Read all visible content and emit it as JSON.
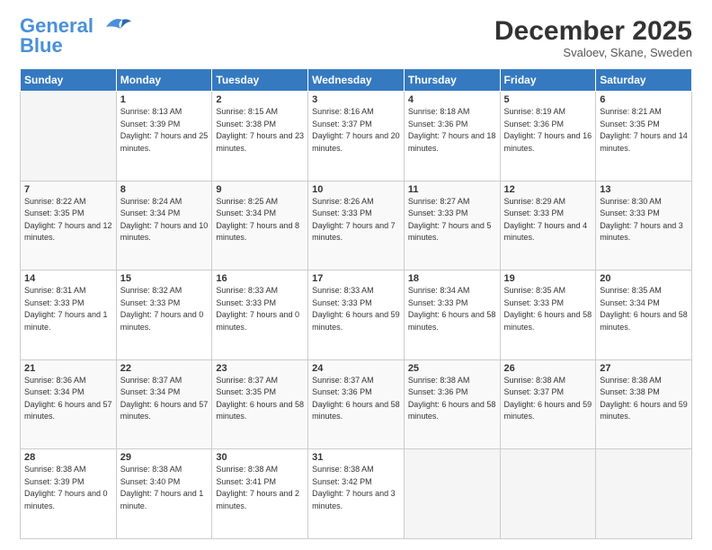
{
  "logo": {
    "general": "General",
    "blue": "Blue"
  },
  "header": {
    "month": "December 2025",
    "location": "Svaloev, Skane, Sweden"
  },
  "days_of_week": [
    "Sunday",
    "Monday",
    "Tuesday",
    "Wednesday",
    "Thursday",
    "Friday",
    "Saturday"
  ],
  "weeks": [
    [
      {
        "num": "",
        "sunrise": "",
        "sunset": "",
        "daylight": "",
        "empty": true
      },
      {
        "num": "1",
        "sunrise": "Sunrise: 8:13 AM",
        "sunset": "Sunset: 3:39 PM",
        "daylight": "Daylight: 7 hours and 25 minutes."
      },
      {
        "num": "2",
        "sunrise": "Sunrise: 8:15 AM",
        "sunset": "Sunset: 3:38 PM",
        "daylight": "Daylight: 7 hours and 23 minutes."
      },
      {
        "num": "3",
        "sunrise": "Sunrise: 8:16 AM",
        "sunset": "Sunset: 3:37 PM",
        "daylight": "Daylight: 7 hours and 20 minutes."
      },
      {
        "num": "4",
        "sunrise": "Sunrise: 8:18 AM",
        "sunset": "Sunset: 3:36 PM",
        "daylight": "Daylight: 7 hours and 18 minutes."
      },
      {
        "num": "5",
        "sunrise": "Sunrise: 8:19 AM",
        "sunset": "Sunset: 3:36 PM",
        "daylight": "Daylight: 7 hours and 16 minutes."
      },
      {
        "num": "6",
        "sunrise": "Sunrise: 8:21 AM",
        "sunset": "Sunset: 3:35 PM",
        "daylight": "Daylight: 7 hours and 14 minutes."
      }
    ],
    [
      {
        "num": "7",
        "sunrise": "Sunrise: 8:22 AM",
        "sunset": "Sunset: 3:35 PM",
        "daylight": "Daylight: 7 hours and 12 minutes."
      },
      {
        "num": "8",
        "sunrise": "Sunrise: 8:24 AM",
        "sunset": "Sunset: 3:34 PM",
        "daylight": "Daylight: 7 hours and 10 minutes."
      },
      {
        "num": "9",
        "sunrise": "Sunrise: 8:25 AM",
        "sunset": "Sunset: 3:34 PM",
        "daylight": "Daylight: 7 hours and 8 minutes."
      },
      {
        "num": "10",
        "sunrise": "Sunrise: 8:26 AM",
        "sunset": "Sunset: 3:33 PM",
        "daylight": "Daylight: 7 hours and 7 minutes."
      },
      {
        "num": "11",
        "sunrise": "Sunrise: 8:27 AM",
        "sunset": "Sunset: 3:33 PM",
        "daylight": "Daylight: 7 hours and 5 minutes."
      },
      {
        "num": "12",
        "sunrise": "Sunrise: 8:29 AM",
        "sunset": "Sunset: 3:33 PM",
        "daylight": "Daylight: 7 hours and 4 minutes."
      },
      {
        "num": "13",
        "sunrise": "Sunrise: 8:30 AM",
        "sunset": "Sunset: 3:33 PM",
        "daylight": "Daylight: 7 hours and 3 minutes."
      }
    ],
    [
      {
        "num": "14",
        "sunrise": "Sunrise: 8:31 AM",
        "sunset": "Sunset: 3:33 PM",
        "daylight": "Daylight: 7 hours and 1 minute."
      },
      {
        "num": "15",
        "sunrise": "Sunrise: 8:32 AM",
        "sunset": "Sunset: 3:33 PM",
        "daylight": "Daylight: 7 hours and 0 minutes."
      },
      {
        "num": "16",
        "sunrise": "Sunrise: 8:33 AM",
        "sunset": "Sunset: 3:33 PM",
        "daylight": "Daylight: 7 hours and 0 minutes."
      },
      {
        "num": "17",
        "sunrise": "Sunrise: 8:33 AM",
        "sunset": "Sunset: 3:33 PM",
        "daylight": "Daylight: 6 hours and 59 minutes."
      },
      {
        "num": "18",
        "sunrise": "Sunrise: 8:34 AM",
        "sunset": "Sunset: 3:33 PM",
        "daylight": "Daylight: 6 hours and 58 minutes."
      },
      {
        "num": "19",
        "sunrise": "Sunrise: 8:35 AM",
        "sunset": "Sunset: 3:33 PM",
        "daylight": "Daylight: 6 hours and 58 minutes."
      },
      {
        "num": "20",
        "sunrise": "Sunrise: 8:35 AM",
        "sunset": "Sunset: 3:34 PM",
        "daylight": "Daylight: 6 hours and 58 minutes."
      }
    ],
    [
      {
        "num": "21",
        "sunrise": "Sunrise: 8:36 AM",
        "sunset": "Sunset: 3:34 PM",
        "daylight": "Daylight: 6 hours and 57 minutes."
      },
      {
        "num": "22",
        "sunrise": "Sunrise: 8:37 AM",
        "sunset": "Sunset: 3:34 PM",
        "daylight": "Daylight: 6 hours and 57 minutes."
      },
      {
        "num": "23",
        "sunrise": "Sunrise: 8:37 AM",
        "sunset": "Sunset: 3:35 PM",
        "daylight": "Daylight: 6 hours and 58 minutes."
      },
      {
        "num": "24",
        "sunrise": "Sunrise: 8:37 AM",
        "sunset": "Sunset: 3:36 PM",
        "daylight": "Daylight: 6 hours and 58 minutes."
      },
      {
        "num": "25",
        "sunrise": "Sunrise: 8:38 AM",
        "sunset": "Sunset: 3:36 PM",
        "daylight": "Daylight: 6 hours and 58 minutes."
      },
      {
        "num": "26",
        "sunrise": "Sunrise: 8:38 AM",
        "sunset": "Sunset: 3:37 PM",
        "daylight": "Daylight: 6 hours and 59 minutes."
      },
      {
        "num": "27",
        "sunrise": "Sunrise: 8:38 AM",
        "sunset": "Sunset: 3:38 PM",
        "daylight": "Daylight: 6 hours and 59 minutes."
      }
    ],
    [
      {
        "num": "28",
        "sunrise": "Sunrise: 8:38 AM",
        "sunset": "Sunset: 3:39 PM",
        "daylight": "Daylight: 7 hours and 0 minutes."
      },
      {
        "num": "29",
        "sunrise": "Sunrise: 8:38 AM",
        "sunset": "Sunset: 3:40 PM",
        "daylight": "Daylight: 7 hours and 1 minute."
      },
      {
        "num": "30",
        "sunrise": "Sunrise: 8:38 AM",
        "sunset": "Sunset: 3:41 PM",
        "daylight": "Daylight: 7 hours and 2 minutes."
      },
      {
        "num": "31",
        "sunrise": "Sunrise: 8:38 AM",
        "sunset": "Sunset: 3:42 PM",
        "daylight": "Daylight: 7 hours and 3 minutes."
      },
      {
        "num": "",
        "sunrise": "",
        "sunset": "",
        "daylight": "",
        "empty": true
      },
      {
        "num": "",
        "sunrise": "",
        "sunset": "",
        "daylight": "",
        "empty": true
      },
      {
        "num": "",
        "sunrise": "",
        "sunset": "",
        "daylight": "",
        "empty": true
      }
    ]
  ]
}
